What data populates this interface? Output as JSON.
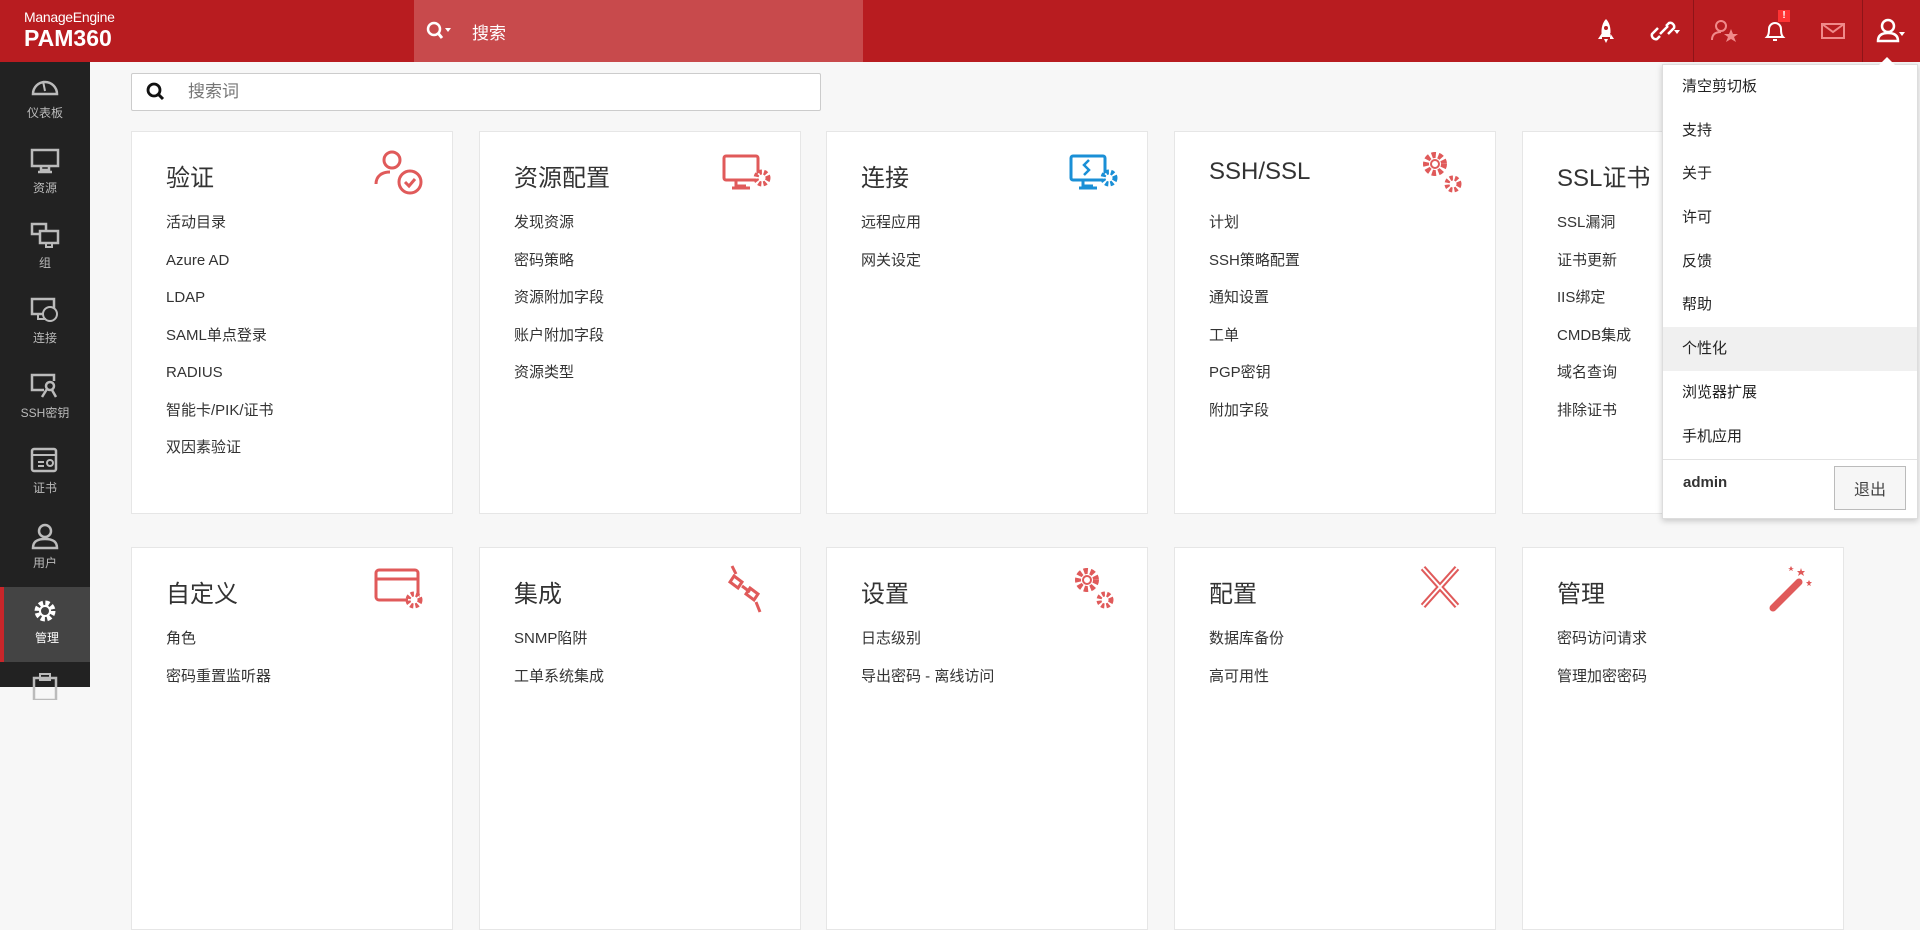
{
  "header": {
    "brand_top": "ManageEngine",
    "brand_product": "PAM360",
    "search_label": "搜索",
    "alert_badge": "!"
  },
  "colors": {
    "header": "#b81c20",
    "accent_icon": "#e05a5a",
    "connection_icon": "#1a8fd6",
    "sidebar": "#222222"
  },
  "sidebar": {
    "items": [
      {
        "label": "仪表板",
        "icon": "dashboard-icon"
      },
      {
        "label": "资源",
        "icon": "monitor-icon"
      },
      {
        "label": "组",
        "icon": "group-icon"
      },
      {
        "label": "连接",
        "icon": "connection-icon"
      },
      {
        "label": "SSH密钥",
        "icon": "ssh-key-icon"
      },
      {
        "label": "证书",
        "icon": "certificate-icon"
      },
      {
        "label": "用户",
        "icon": "user-icon"
      },
      {
        "label": "管理",
        "icon": "gear-icon",
        "active": true
      },
      {
        "label": "",
        "icon": "clipboard-icon"
      }
    ]
  },
  "main": {
    "search_placeholder": "搜索词",
    "cards": [
      {
        "title": "验证",
        "icon": "user-check-icon",
        "items": [
          "活动目录",
          "Azure AD",
          "LDAP",
          "SAML单点登录",
          "RADIUS",
          "智能卡/PIK/证书",
          "双因素验证"
        ]
      },
      {
        "title": "资源配置",
        "icon": "monitor-gear-icon",
        "items": [
          "发现资源",
          "密码策略",
          "资源附加字段",
          "账户附加字段",
          "资源类型"
        ]
      },
      {
        "title": "连接",
        "icon": "remote-gear-icon",
        "items": [
          "远程应用",
          "网关设定"
        ]
      },
      {
        "title": "SSH/SSL",
        "icon": "gears-icon",
        "items": [
          "计划",
          "SSH策略配置",
          "通知设置",
          "工单",
          "PGP密钥",
          "附加字段"
        ]
      },
      {
        "title": "SSL证书",
        "icon": "certificate-icon",
        "items": [
          "SSL漏洞",
          "证书更新",
          "IIS绑定",
          "CMDB集成",
          "域名查询",
          "排除证书"
        ]
      },
      {
        "title": "自定义",
        "icon": "card-gear-icon",
        "items": [
          "角色",
          "密码重置监听器"
        ]
      },
      {
        "title": "集成",
        "icon": "plug-icon",
        "items": [
          "SNMP陷阱",
          "工单系统集成"
        ]
      },
      {
        "title": "设置",
        "icon": "gears-icon",
        "items": [
          "日志级别",
          "导出密码 - 离线访问"
        ]
      },
      {
        "title": "配置",
        "icon": "tools-icon",
        "items": [
          "数据库备份",
          "高可用性"
        ]
      },
      {
        "title": "管理",
        "icon": "magic-wand-icon",
        "items": [
          "密码访问请求",
          "管理加密密码"
        ]
      }
    ]
  },
  "dropdown": {
    "items": [
      "清空剪切板",
      "支持",
      "关于",
      "许可",
      "反馈",
      "帮助",
      "个性化",
      "浏览器扩展",
      "手机应用"
    ],
    "highlighted": "个性化",
    "user": "admin",
    "logout": "退出"
  }
}
